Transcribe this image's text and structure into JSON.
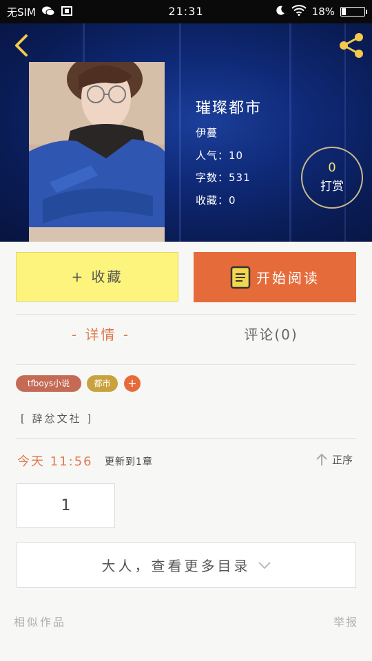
{
  "status_bar": {
    "carrier": "无SIM",
    "time": "21:31",
    "battery": "18%"
  },
  "book": {
    "title": "璀璨都市",
    "author": "伊蔓",
    "popularity": "人气：10",
    "word_count": "字数：531",
    "favorites": "收藏：0",
    "cover_description": "Portrait of young man with glasses in blue jacket"
  },
  "tip": {
    "count": "0",
    "label": "打赏"
  },
  "actions": {
    "collect_label": "+ 收藏",
    "read_label": "开始阅读"
  },
  "tabs": {
    "detail": "- 详情 -",
    "comments": "评论(0)"
  },
  "tags": [
    {
      "label": "tfboys小说",
      "color": "#c46a55"
    },
    {
      "label": "都市",
      "color": "#c9a23d"
    }
  ],
  "tag_add": "+",
  "publisher": "[ 辞忿文社 ]",
  "update": {
    "time": "今天 11:56",
    "text": "更新到1章",
    "sort": "正序"
  },
  "chapter": "1",
  "more_catalog": "大人，查看更多目录",
  "footer": {
    "similar": "相似作品",
    "report": "举报"
  },
  "colors": {
    "accent": "#e66b3b",
    "collect_bg": "#fcf47c",
    "banner": "#0f2a78"
  }
}
